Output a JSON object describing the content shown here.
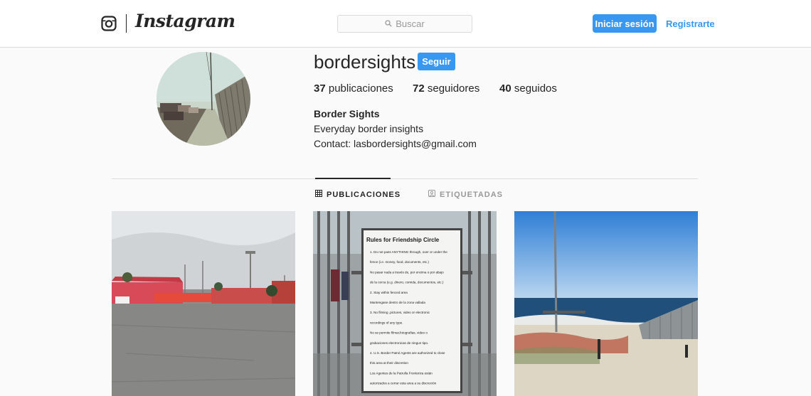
{
  "header": {
    "brand": "Instagram",
    "search_placeholder": "Buscar",
    "login_label": "Iniciar sesión",
    "register_label": "Registrarte"
  },
  "profile": {
    "username": "bordersights",
    "follow_label": "Seguir",
    "stats": {
      "posts_count": "37",
      "posts_label": "publicaciones",
      "followers_count": "72",
      "followers_label": "seguidores",
      "following_count": "40",
      "following_label": "seguidos"
    },
    "bio": {
      "name": "Border Sights",
      "line1": "Everyday border insights",
      "line2": "Contact: lasbordersights@gmail.com"
    }
  },
  "tabs": [
    {
      "label": "PUBLICACIONES",
      "active": true
    },
    {
      "label": "ETIQUETADAS",
      "active": false
    }
  ],
  "posts": [
    {
      "kind": "photo"
    },
    {
      "kind": "photo",
      "sign": {
        "title": "Rules for Friendship Circle",
        "lines": [
          "1. Do not pass ANYTHING through, over or under the",
          "fence (i.e. money, food, documents, etc.)",
          "No pasar nada a través de, por encima o por abajo",
          "de la cerca (e.g. dinero, comida, documentos, etc.)",
          "2. Stay within fenced area",
          "Mantengase dentro de la zona vallada",
          "3. No filming ,pictures, video or electronic",
          "recordings of any type.",
          "No se permite filmar,fotografias, video o",
          "grabaciones electronicas de ningun tipo.",
          "4. U.S. Border Patrol Agents are authorized to close",
          "this area at their discretion",
          "Los Agentes de la Patrulla Fronteriza están",
          "autorizados a cerrar esta area a su discreción"
        ]
      }
    },
    {
      "kind": "photo"
    }
  ],
  "colors": {
    "accent": "#3897f0",
    "text": "#262626",
    "muted": "#999999",
    "border": "#dbdbdb",
    "background": "#fafafa"
  },
  "icons": [
    "instagram-glyph-icon",
    "search-icon",
    "grid-icon",
    "tagged-icon"
  ]
}
